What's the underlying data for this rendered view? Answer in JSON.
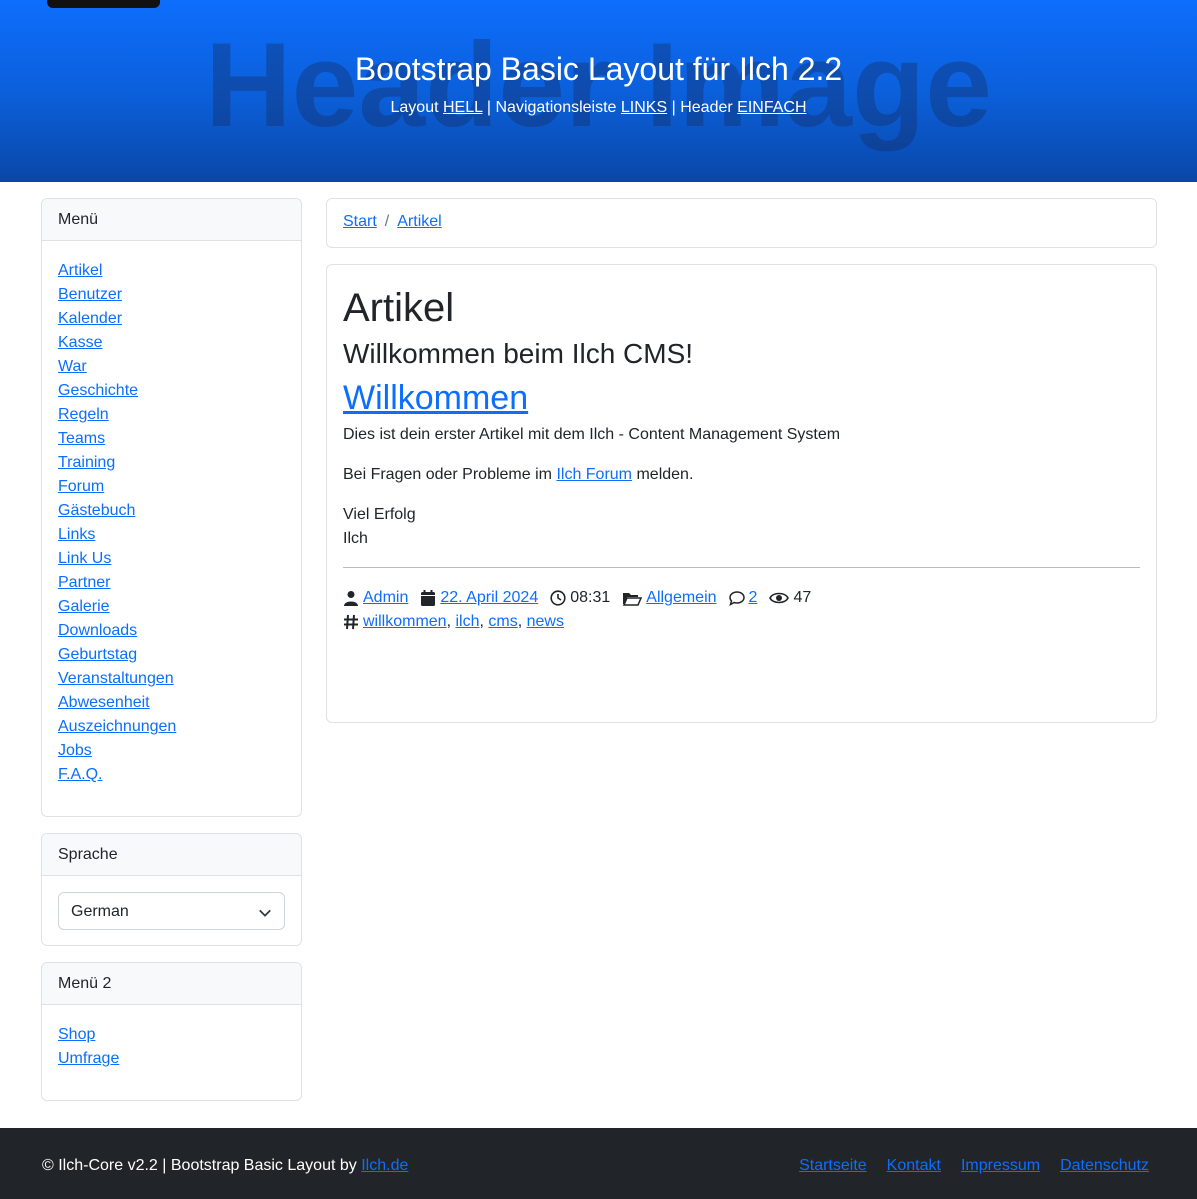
{
  "header": {
    "watermark": "Header Image",
    "title": "Bootstrap Basic Layout für Ilch 2.2",
    "sub_layout": "Layout",
    "sub_layout_val": "HELL",
    "sub_nav": "Navigationsleiste",
    "sub_nav_val": "LINKS",
    "sub_header": "Header",
    "sub_header_val": "EINFACH",
    "sep": "|"
  },
  "sidebar": {
    "menu_title": "Menü",
    "menu_items": [
      "Artikel",
      "Benutzer",
      "Kalender",
      "Kasse",
      "War",
      "Geschichte",
      "Regeln",
      "Teams",
      "Training",
      "Forum",
      "Gästebuch",
      "Links",
      "Link Us",
      "Partner",
      "Galerie",
      "Downloads",
      "Geburtstag",
      "Veranstaltungen",
      "Abwesenheit",
      "Auszeichnungen",
      "Jobs",
      "F.A.Q."
    ],
    "language_title": "Sprache",
    "language_value": "German",
    "menu2_title": "Menü 2",
    "menu2_items": [
      "Shop",
      "Umfrage"
    ]
  },
  "breadcrumb": {
    "start": "Start",
    "sep": "/",
    "current": "Artikel"
  },
  "article": {
    "heading": "Artikel",
    "subheading": "Willkommen beim Ilch CMS!",
    "title": "Willkommen",
    "intro": "Dies ist dein erster Artikel mit dem Ilch - Content Management System",
    "questions_pre": "Bei Fragen oder Probleme im",
    "questions_link": "Ilch Forum",
    "questions_post": "melden.",
    "closing1": "Viel Erfolg",
    "closing2": "Ilch",
    "meta": {
      "author": "Admin",
      "date": "22. April 2024",
      "time": "08:31",
      "category": "Allgemein",
      "comments": "2",
      "views": "47",
      "tags": [
        "willkommen",
        "ilch",
        "cms",
        "news"
      ]
    }
  },
  "footer": {
    "copyright": "© Ilch-Core v2.2 | Bootstrap Basic Layout by",
    "copyright_link": "Ilch.de",
    "links": [
      "Startseite",
      "Kontakt",
      "Impressum",
      "Datenschutz"
    ]
  }
}
